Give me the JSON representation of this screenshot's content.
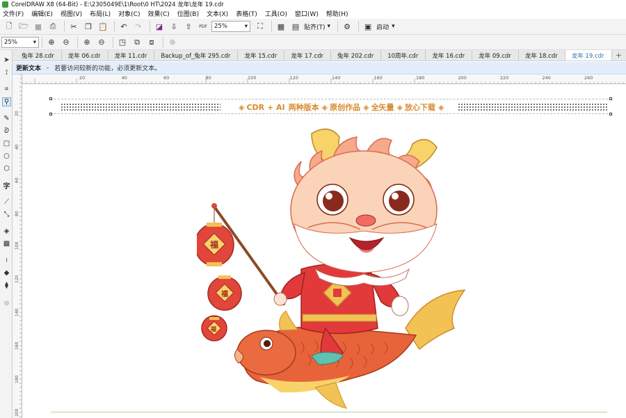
{
  "window": {
    "title": "CorelDRAW X8 (64-Bit) - E:\\2305049E\\1\\Root\\0 HT\\2024 龙年\\龙年 19.cdr"
  },
  "menu": [
    "文件(F)",
    "编辑(E)",
    "视图(V)",
    "布局(L)",
    "对象(C)",
    "效果(C)",
    "位图(B)",
    "文本(X)",
    "表格(T)",
    "工具(O)",
    "窗口(W)",
    "帮助(H)"
  ],
  "toolbar": {
    "zoom_value": "25%",
    "snap_label": "贴齐(T)",
    "launch_label": "启动",
    "pdf_label": "PDF"
  },
  "toolbar2": {
    "zoom_value": "25%"
  },
  "tabs": [
    "兔年 28.cdr",
    "龙年 06.cdr",
    "龙年 11.cdr",
    "Backup_of_兔年 295.cdr",
    "龙年 15.cdr",
    "龙年 17.cdr",
    "兔年 202.cdr",
    "10周年.cdr",
    "龙年 16.cdr",
    "龙年 09.cdr",
    "龙年 18.cdr",
    "龙年 19.cdr"
  ],
  "active_tab": 11,
  "infobar": {
    "title": "更新文本",
    "dash": "-",
    "message": "若要访问较新的功能，必须更新文本。"
  },
  "ruler": {
    "labels": [
      "20",
      "40",
      "60",
      "80",
      "100",
      "120",
      "140",
      "160",
      "180",
      "200",
      "220",
      "240",
      "260"
    ]
  },
  "vruler": {
    "labels": [
      "20",
      "40",
      "60",
      "80",
      "100",
      "120",
      "140",
      "160",
      "180",
      "200"
    ]
  },
  "banner": {
    "part1": "CDR + AI",
    "part2": "两种版本",
    "part3": "原创作品",
    "part4": "全矢量",
    "part5": "放心下载"
  },
  "lantern_char": "福",
  "colors": {
    "accent": "#2a6fb6",
    "banner_text": "#d88a2c",
    "info_bg": "#e3eefa"
  }
}
